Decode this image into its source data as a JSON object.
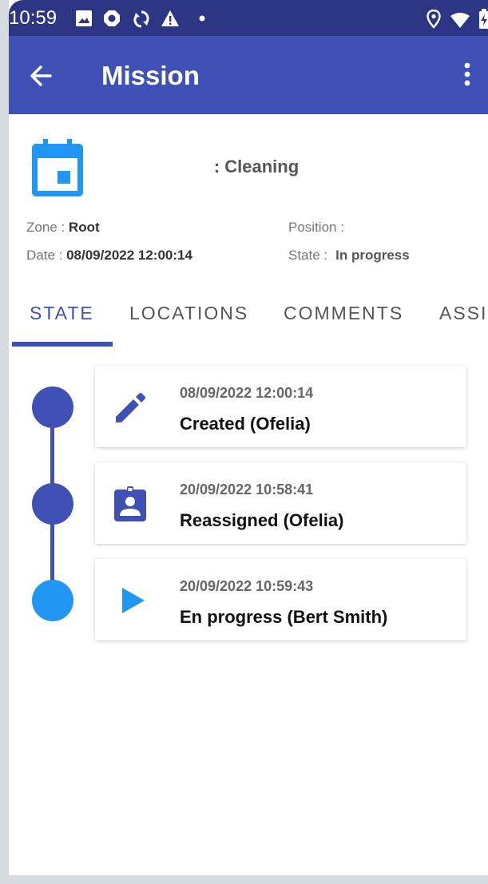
{
  "status_bar": {
    "time": "10:59",
    "icons": [
      "image-icon",
      "octagon-icon",
      "sync-icon",
      "warning-icon",
      "dot-icon",
      "location-icon",
      "wifi-icon",
      "battery-icon"
    ]
  },
  "app_bar": {
    "title": "Mission",
    "back_icon": "arrow-back-icon",
    "menu_icon": "more-vert-icon"
  },
  "header": {
    "icon": "calendar-icon",
    "mission_type": ": Cleaning",
    "zone_label": "Zone : ",
    "zone_value": "Root",
    "position_label": "Position :",
    "date_label": "Date : ",
    "date_value": "08/09/2022 12:00:14",
    "state_label": "State :",
    "state_value": "In progress"
  },
  "tabs": [
    {
      "label": "STATE",
      "active": true
    },
    {
      "label": "LOCATIONS",
      "active": false
    },
    {
      "label": "COMMENTS",
      "active": false
    },
    {
      "label": "ASSI",
      "active": false
    }
  ],
  "timeline": [
    {
      "date": "08/09/2022 12:00:14",
      "label": "Created (Ofelia)",
      "icon": "pencil-icon",
      "dot_color": "#3f51b5"
    },
    {
      "date": "20/09/2022 10:58:41",
      "label": "Reassigned (Ofelia)",
      "icon": "assignment-ind-icon",
      "dot_color": "#3f51b5"
    },
    {
      "date": "20/09/2022 10:59:43",
      "label": "En progress (Bert Smith)",
      "icon": "play-icon",
      "dot_color": "#2196f3"
    }
  ],
  "colors": {
    "status_bar": "#2c3685",
    "primary": "#3f51b5",
    "accent": "#2196f3"
  }
}
